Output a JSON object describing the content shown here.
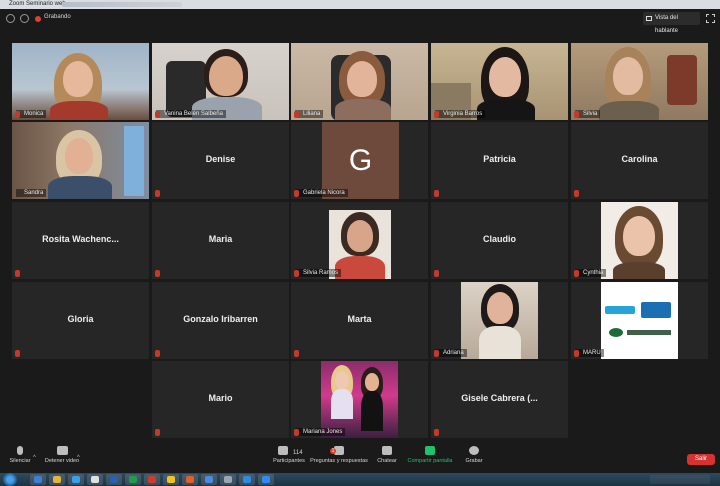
{
  "window": {
    "title": "Zoom Seminario web"
  },
  "topbar": {
    "recording_label": "Grabando",
    "view_button_label": "Vista del hablante"
  },
  "participants": [
    {
      "name": "Monica",
      "kind": "video"
    },
    {
      "name": "Vanina Belén Salbeña",
      "kind": "video"
    },
    {
      "name": "Liliana",
      "kind": "video"
    },
    {
      "name": "Virginia Barros",
      "kind": "video"
    },
    {
      "name": "Silvia",
      "kind": "video"
    },
    {
      "name": "Sandra",
      "kind": "video",
      "active": true
    },
    {
      "name": "Denise",
      "kind": "name"
    },
    {
      "name": "Gabriela Nicora",
      "kind": "initial",
      "initial": "G"
    },
    {
      "name": "Patricia",
      "kind": "name"
    },
    {
      "name": "Carolina",
      "kind": "name"
    },
    {
      "name": "Rosita  Wachenc...",
      "kind": "name"
    },
    {
      "name": "Maria",
      "kind": "name"
    },
    {
      "name": "Silvia Ramos",
      "kind": "photo"
    },
    {
      "name": "Claudio",
      "kind": "name"
    },
    {
      "name": "Cynthia",
      "kind": "photo"
    },
    {
      "name": "Gloria",
      "kind": "name"
    },
    {
      "name": "Gonzalo Iribarren",
      "kind": "name"
    },
    {
      "name": "Marta",
      "kind": "name"
    },
    {
      "name": "Adriana",
      "kind": "photo"
    },
    {
      "name": "MARU",
      "kind": "logo"
    },
    {
      "name": "Mario",
      "kind": "name"
    },
    {
      "name": "Mariana Jones",
      "kind": "photo"
    },
    {
      "name": "Gisele Cabrera (...",
      "kind": "name"
    }
  ],
  "toolbar": {
    "mute_label": "Silenciar",
    "video_label": "Detener video",
    "participants_label": "Participantes",
    "participants_count": "114",
    "qa_label": "Preguntas y respuestas",
    "qa_badge": "1",
    "chat_label": "Chatear",
    "share_label": "Compartir pantalla",
    "record_label": "Grabar",
    "leave_label": "Salir"
  },
  "colors": {
    "recording": "#e0402f",
    "share_green": "#1fc16b",
    "leave_red": "#d63232",
    "active_speaker": "#e8e234"
  }
}
